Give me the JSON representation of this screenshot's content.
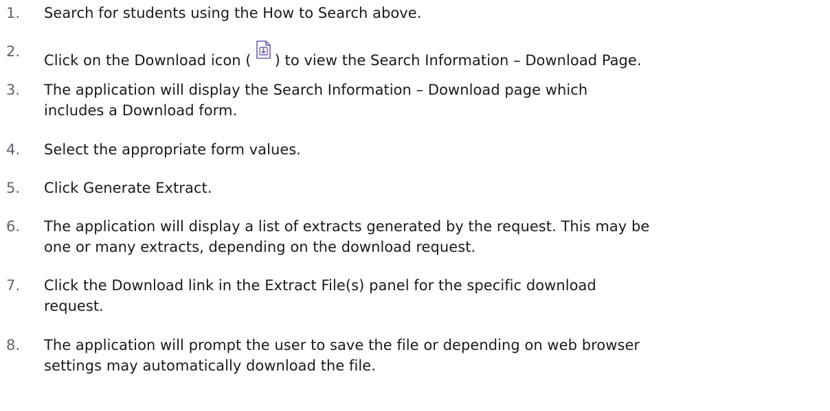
{
  "steps": [
    {
      "num": "1.",
      "lines": [
        "Search for students using the How to Search above."
      ]
    },
    {
      "num": "2.",
      "text_before": "Click on the Download icon (",
      "icon": "download-icon",
      "text_after": ") to view the Search Information – Download Page."
    },
    {
      "num": "3.",
      "lines": [
        "The application will display the Search Information – Download page which",
        "includes a Download form."
      ]
    },
    {
      "num": "4.",
      "lines": [
        "Select the appropriate form values."
      ]
    },
    {
      "num": "5.",
      "lines": [
        "Click Generate Extract."
      ]
    },
    {
      "num": "6.",
      "lines": [
        "The application will display a list of extracts generated by the request. This may be",
        "one or many extracts, depending on the download request."
      ]
    },
    {
      "num": "7.",
      "lines": [
        "Click the Download link in the Extract File(s) panel for the specific download",
        "request."
      ]
    },
    {
      "num": "8.",
      "lines": [
        "The application will prompt the user to save the file or depending on web browser",
        "settings may automatically download the file."
      ]
    }
  ],
  "colors": {
    "text": "#1a1a1a",
    "number": "#5f6368",
    "icon": "#6f5fb0"
  }
}
